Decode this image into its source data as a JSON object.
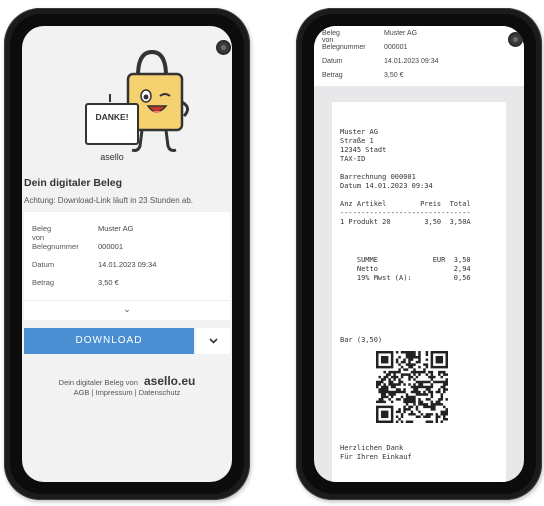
{
  "left_screen": {
    "sign_text": "DANKE!",
    "sign_logo": "asello",
    "heading": "Dein digitaler Beleg",
    "notice": "Achtung: Download-Link läuft in 23 Stunden ab.",
    "rows": [
      {
        "label": "Beleg von",
        "value": "Muster AG"
      },
      {
        "label": "Belegnummer",
        "value": "000001"
      },
      {
        "label": "Datum",
        "value": "14.01.2023 09:34"
      },
      {
        "label": "Betrag",
        "value": "3,50 €"
      }
    ],
    "expand_icon": "chevron-down-icon",
    "download_label": "DOWNLOAD",
    "download_dropdown_icon": "chevron-down-icon",
    "footer_text": "Dein digitaler Beleg von",
    "footer_brand": "asello.eu",
    "footer_links": "AGB | Impressum | Datenschutz"
  },
  "right_screen": {
    "rows": [
      {
        "label": "Beleg von",
        "value": "Muster AG"
      },
      {
        "label": "Belegnummer",
        "value": "000001"
      },
      {
        "label": "Datum",
        "value": "14.01.2023 09:34"
      },
      {
        "label": "Betrag",
        "value": "3,50 €"
      }
    ],
    "receipt_lines": [
      "Muster AG",
      "Straße 1",
      "12345 Stadt",
      "TAX-ID",
      "",
      "Barrechnung 000001",
      "Datum 14.01.2023 09:34",
      "",
      "Anz Artikel        Preis  Total",
      "-------------------------------",
      "1 Produkt 20        3,50  3,50A",
      "",
      "",
      "    SUMME             EUR  3,50",
      "    Netto                  2,94",
      "    19% Mwst (A):          0,56",
      "",
      "",
      "Bar (3,50)"
    ],
    "receipt_footer": [
      "Herzlichen Dank",
      "Für Ihren Einkauf"
    ]
  },
  "colors": {
    "accent_blue": "#4a8fd2",
    "mascot_yellow": "#f5d170",
    "phone_frame": "#1b1b1d"
  }
}
